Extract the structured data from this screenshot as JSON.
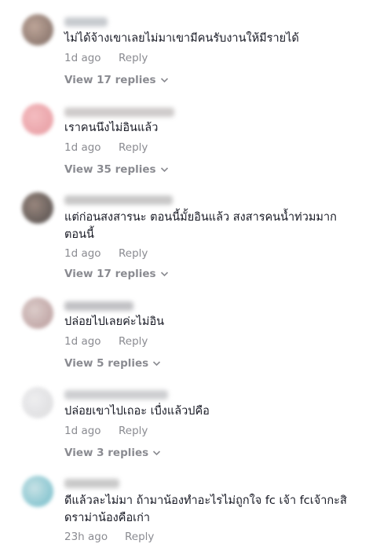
{
  "comments": [
    {
      "text": "ไม่ได้จ้างเขาเลยไม่มาเขามีคนรับงานให้มีรายได้",
      "time": "1d ago",
      "reply": "Reply",
      "view_replies": "View 17 replies",
      "avatar_colors": [
        "#6f5a52",
        "#b79c8e"
      ],
      "username_color": "#9aa0a8"
    },
    {
      "text": "เราคนนึงไม่อินแล้ว",
      "time": "1d ago",
      "reply": "Reply",
      "view_replies": "View 35 replies",
      "avatar_colors": [
        "#e48f96",
        "#f3b6ba"
      ],
      "username_color": "#a7a1a0"
    },
    {
      "text": "แต่ก่อนสงสารนะ ตอนนี้มั้ยอินแล้ว สงสารคนน้ำท่วมมาก ตอนนี้",
      "time": "1d ago",
      "reply": "Reply",
      "view_replies": "View 17 replies",
      "avatar_colors": [
        "#3d3837",
        "#8e7a70"
      ],
      "username_color": "#9b9a9a"
    },
    {
      "text": "ปล่อยไปเลยค่ะไม่อิน",
      "time": "1d ago",
      "reply": "Reply",
      "view_replies": "View 5 replies",
      "avatar_colors": [
        "#b08e8f",
        "#d8c7c4"
      ],
      "username_color": "#8f8f95"
    },
    {
      "text": "ปล่อยเขาไปเถอะ เบื่งแล้วปคือ",
      "time": "1d ago",
      "reply": "Reply",
      "view_replies": "View 3 replies",
      "avatar_colors": [
        "#d7d7d9",
        "#ececee"
      ],
      "username_color": "#a5a6ab"
    },
    {
      "text": "ดีแล้วละไม่มา ถ้ามาน้องทำอะไรไม่ถูกใจ fc เจ้า fcเจ้ากะสิดราม่าน้องคือเก่า",
      "time": "23h ago",
      "reply": "Reply",
      "avatar_colors": [
        "#5fb3c2",
        "#c2dfe3"
      ],
      "username_color": "#9e9e9e"
    }
  ]
}
